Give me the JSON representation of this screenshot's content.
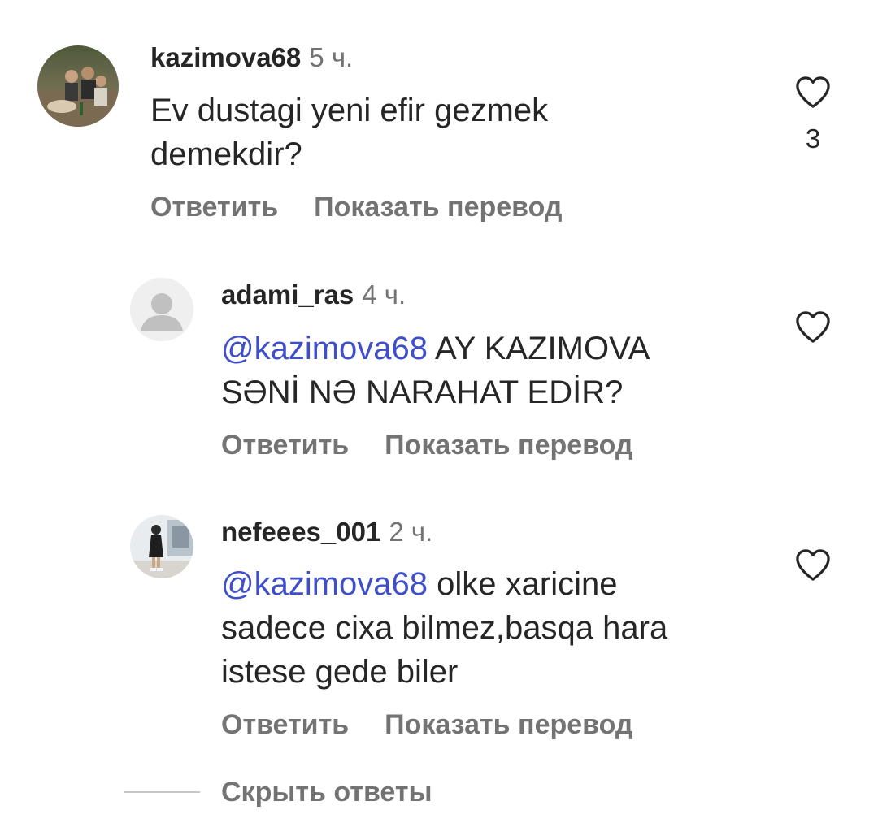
{
  "comments": [
    {
      "username": "kazimova68",
      "time": "5 ч.",
      "mention": "",
      "text_lines": [
        "Ev dustagi yeni efir gezmek",
        "demekdir?"
      ],
      "likes": "3",
      "reply_label": "Ответить",
      "translate_label": "Показать перевод",
      "avatar": "photo-avatar"
    },
    {
      "username": "adami_ras",
      "time": "4 ч.",
      "mention": "@kazimova68",
      "text_first": " AY KAZIMOVA",
      "text_lines": [
        "SƏNİ NƏ NARAHAT EDİR?"
      ],
      "likes": "",
      "reply_label": "Ответить",
      "translate_label": "Показать перевод",
      "avatar": "default-user-avatar"
    },
    {
      "username": "nefeees_001",
      "time": "2 ч.",
      "mention": "@kazimova68",
      "text_first": " olke xaricine",
      "text_lines": [
        "sadece cixa bilmez,basqa hara",
        "istese gede biler"
      ],
      "likes": "",
      "reply_label": "Ответить",
      "translate_label": "Показать перевод",
      "avatar": "photo-avatar"
    }
  ],
  "hide_replies_label": "Скрыть ответы",
  "icons": {
    "like": "heart-outline-icon",
    "default_avatar": "person-silhouette-icon"
  },
  "colors": {
    "mention": "#3f4fc9",
    "secondary_text": "#737373",
    "primary_text": "#262626"
  }
}
